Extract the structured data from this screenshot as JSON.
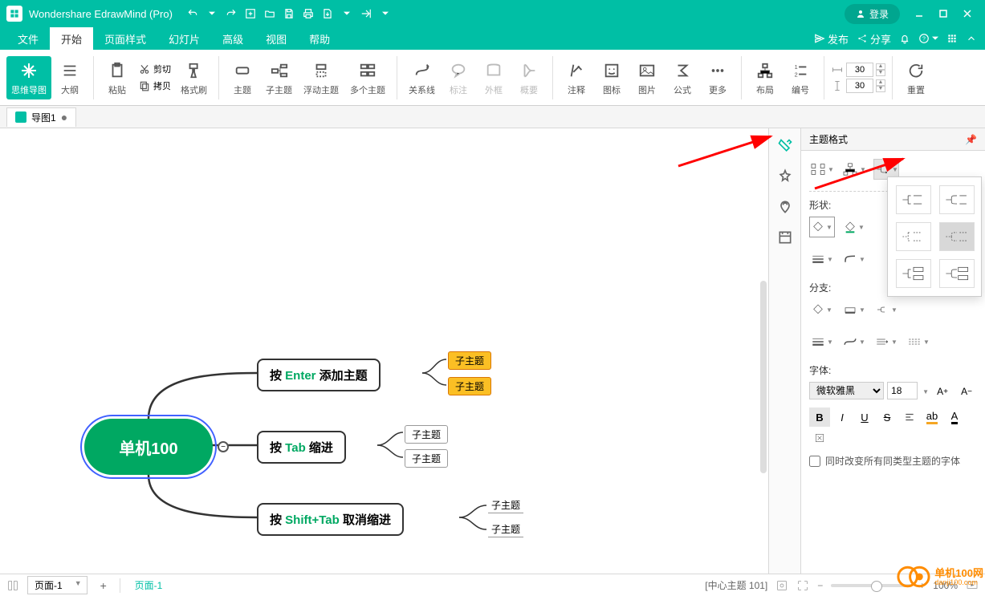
{
  "app": {
    "title": "Wondershare EdrawMind (Pro)",
    "login": "登录"
  },
  "menu": {
    "items": [
      "文件",
      "开始",
      "页面样式",
      "幻灯片",
      "高级",
      "视图",
      "帮助"
    ],
    "active_index": 1,
    "publish": "发布",
    "share": "分享"
  },
  "ribbon": {
    "mindmap": "思维导图",
    "outline": "大纲",
    "paste": "粘贴",
    "cut": "剪切",
    "copy": "拷贝",
    "format_painter": "格式刷",
    "topic": "主题",
    "subtopic": "子主题",
    "floating": "浮动主题",
    "multiple": "多个主题",
    "relation": "关系线",
    "callout": "标注",
    "boundary": "外框",
    "summary": "概要",
    "comment": "注释",
    "icon": "图标",
    "image": "图片",
    "formula": "公式",
    "more": "更多",
    "layout": "布局",
    "numbering": "编号",
    "width1": "30",
    "width2": "30",
    "reset": "重置"
  },
  "doctab": {
    "name": "导图1"
  },
  "canvas": {
    "central": "单机100",
    "n1_pre": "按 ",
    "n1_kw": "Enter",
    "n1_suf": " 添加主题",
    "n2_pre": "按 ",
    "n2_kw": "Tab",
    "n2_suf": " 缩进",
    "n3_pre": "按 ",
    "n3_kw": "Shift+Tab",
    "n3_suf": " 取消缩进",
    "sub": "子主题"
  },
  "rightpanel": {
    "title": "主题格式",
    "shape": "形状:",
    "branch": "分支:",
    "font": "字体:",
    "font_family": "微软雅黑",
    "font_size": "18",
    "same_type": "同时改变所有同类型主题的字体"
  },
  "statusbar": {
    "page_select": "页面-1",
    "page_current": "页面-1",
    "selection": "[中心主题 101]",
    "zoom": "100%"
  },
  "watermark": {
    "name": "单机100网",
    "url": "danji100.com"
  }
}
